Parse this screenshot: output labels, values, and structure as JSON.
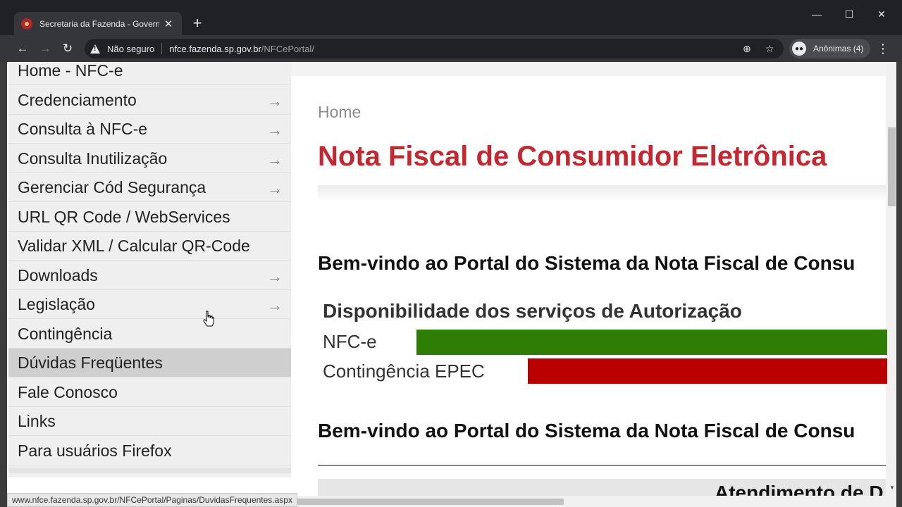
{
  "browser": {
    "tab_title": "Secretaria da Fazenda - Governo",
    "tab_close": "✕",
    "new_tab": "+",
    "window_controls": {
      "minimize": "—",
      "maximize": "☐",
      "close": "✕"
    },
    "nav": {
      "back": "←",
      "forward": "→",
      "reload": "↻"
    },
    "security_label": "Não seguro",
    "url_host": "nfce.fazenda.sp.gov.br",
    "url_path": "/NFCePortal/",
    "zoom_icon": "⊕",
    "star_icon": "☆",
    "profile_label": "Anônimas (4)",
    "menu_icon": "⋮",
    "status_url": "www.nfce.fazenda.sp.gov.br/NFCePortal/Paginas/DuvidasFrequentes.aspx"
  },
  "sidebar": {
    "items": [
      {
        "label": "Home - NFC-e",
        "arrow": ""
      },
      {
        "label": "Credenciamento",
        "arrow": "→"
      },
      {
        "label": "Consulta à NFC-e",
        "arrow": "→"
      },
      {
        "label": "Consulta Inutilização",
        "arrow": "→"
      },
      {
        "label": "Gerenciar Cód Segurança",
        "arrow": "→"
      },
      {
        "label": "URL QR Code / WebServices",
        "arrow": ""
      },
      {
        "label": "Validar XML / Calcular QR-Code",
        "arrow": ""
      },
      {
        "label": "Downloads",
        "arrow": "→"
      },
      {
        "label": "Legislação",
        "arrow": "→"
      },
      {
        "label": "Contingência",
        "arrow": ""
      },
      {
        "label": "Dúvidas Freqüentes",
        "arrow": ""
      },
      {
        "label": "Fale Conosco",
        "arrow": ""
      },
      {
        "label": "Links",
        "arrow": ""
      },
      {
        "label": "Para usuários Firefox",
        "arrow": ""
      }
    ],
    "active_index": 10
  },
  "main": {
    "breadcrumb": "Home",
    "title": "Nota Fiscal de Consumidor Eletrônica",
    "welcome_1": "Bem-vindo ao Portal do Sistema da Nota Fiscal de Consu",
    "availability_title": "Disponibilidade dos serviços de Autorização",
    "services": [
      {
        "name": "NFC-e",
        "status_color": "#2e7d04"
      },
      {
        "name": "Contingência EPEC",
        "status_color": "#bb0000"
      }
    ],
    "welcome_2": "Bem-vindo ao Portal do Sistema da Nota Fiscal de Consu",
    "atendimento": "Atendimento de D"
  }
}
